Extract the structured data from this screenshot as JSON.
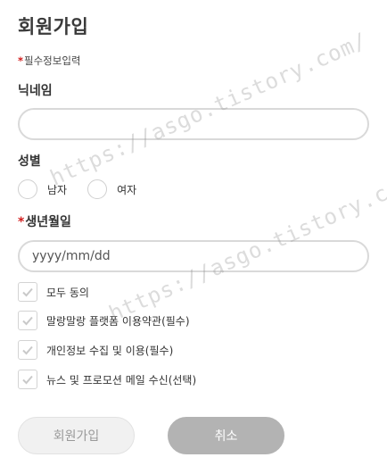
{
  "form": {
    "title": "회원가입",
    "required_note": "필수정보입력",
    "required_mark": "*"
  },
  "nickname": {
    "label": "닉네임",
    "value": "",
    "placeholder": ""
  },
  "gender": {
    "label": "성별",
    "options": [
      "남자",
      "여자"
    ]
  },
  "birthdate": {
    "label": "생년월일",
    "value": "",
    "placeholder": "yyyy/mm/dd"
  },
  "agreements": [
    {
      "label": "모두 동의",
      "checked": false
    },
    {
      "label": "말랑말랑 플랫폼 이용약관(필수)",
      "checked": false
    },
    {
      "label": "개인정보 수집 및 이용(필수)",
      "checked": false
    },
    {
      "label": "뉴스 및 프로모션 메일 수신(선택)",
      "checked": false
    }
  ],
  "buttons": {
    "join_label": "회원가입",
    "cancel_label": "취소"
  },
  "watermark": {
    "text": "https://asgo.tistory.com/"
  },
  "colors": {
    "required": "#d21c1c",
    "border": "#d9d9d9",
    "cancel_bg": "#b3b3b3",
    "join_bg": "#f1f1f1",
    "check": "#c9c9c9"
  }
}
